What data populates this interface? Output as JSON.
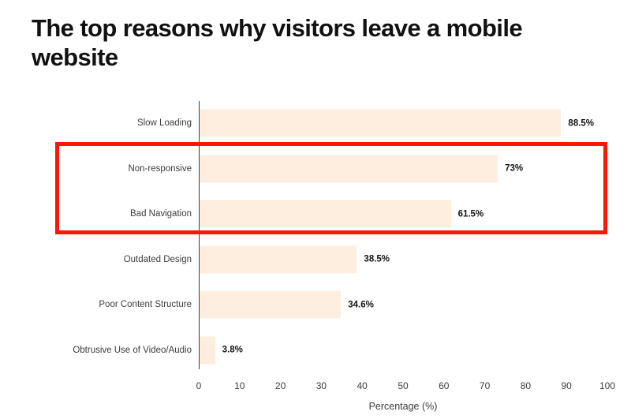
{
  "chart_data": {
    "type": "bar",
    "orientation": "horizontal",
    "title": "The top reasons why visitors leave a mobile website",
    "xlabel": "Percentage (%)",
    "ylabel": "",
    "xlim": [
      0,
      100
    ],
    "xticks": [
      "0",
      "10",
      "20",
      "30",
      "40",
      "50",
      "60",
      "70",
      "80",
      "90",
      "100"
    ],
    "grid": false,
    "legend": null,
    "bar_color": "#fdeee0",
    "categories": [
      "Slow Loading",
      "Non-responsive",
      "Bad Navigation",
      "Outdated Design",
      "Poor Content Structure",
      "Obtrusive Use of Video/Audio"
    ],
    "values": [
      88.5,
      73,
      61.5,
      38.5,
      34.6,
      3.8
    ],
    "value_labels": [
      "88.5%",
      "73%",
      "61.5%",
      "38.5%",
      "34.6%",
      "3.8%"
    ],
    "annotations": [
      {
        "type": "highlight-rectangle",
        "color": "#fb1605",
        "covers": [
          "Non-responsive",
          "Bad Navigation"
        ]
      }
    ]
  }
}
